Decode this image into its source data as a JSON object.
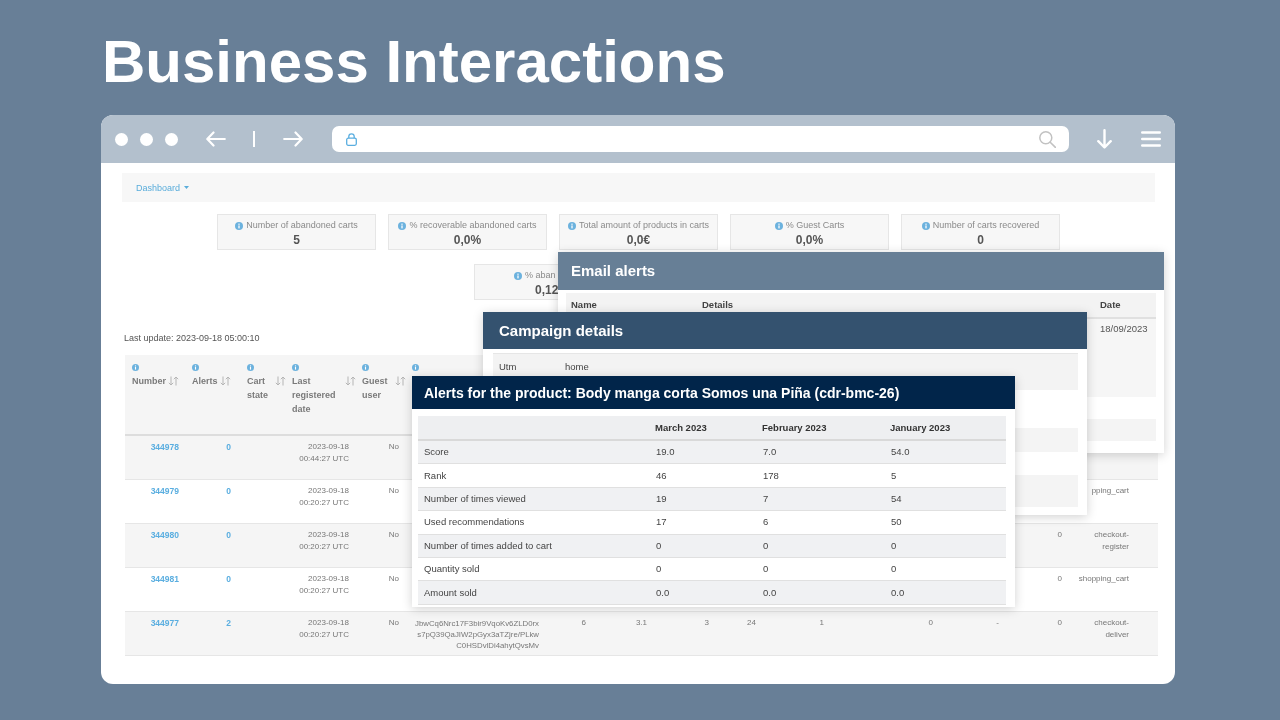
{
  "title": "Business Interactions",
  "dashboard_menu": {
    "label": "Dashboard"
  },
  "stats": [
    {
      "label": "Number of abandoned carts",
      "value": "5"
    },
    {
      "label": "% recoverable abandoned carts",
      "value": "0,0%"
    },
    {
      "label": "Total amount of products in carts",
      "value": "0,0€"
    },
    {
      "label": "% Guest Carts",
      "value": "0,0%"
    },
    {
      "label": "Number of carts recovered",
      "value": "0"
    }
  ],
  "stats_row_2": [
    {
      "label": "% aban",
      "value": "0,12"
    }
  ],
  "last_update": "Last update: 2023-09-18 05:00:10",
  "table": {
    "columns": [
      {
        "kind": "sortable",
        "label": "Number"
      },
      {
        "kind": "sortable",
        "label": "Alerts"
      },
      {
        "kind": "sortable",
        "label": "Cart state"
      },
      {
        "kind": "sortable",
        "label": "Last registered date"
      },
      {
        "kind": "sortable",
        "label": "Guest user"
      },
      {
        "kind": "info_only"
      }
    ],
    "rows": [
      {
        "number": "344978",
        "alerts": "0",
        "date": "2023-09-18",
        "time": "00:44:27 UTC",
        "guest_user": "No"
      },
      {
        "number": "344979",
        "alerts": "0",
        "date": "2023-09-18",
        "time": "00:20:27 UTC",
        "guest_user": "No",
        "column_15": "pping_cart"
      },
      {
        "number": "344980",
        "alerts": "0",
        "date": "2023-09-18",
        "time": "00:20:27 UTC",
        "guest_user": "No",
        "column_14": "0",
        "column_15": "checkout-register"
      },
      {
        "number": "344981",
        "alerts": "0",
        "date": "2023-09-18",
        "time": "00:20:27 UTC",
        "guest_user": "No",
        "column_14": "0",
        "column_15": "shopping_cart"
      },
      {
        "number": "344977",
        "alerts": "2",
        "date": "2023-09-18",
        "time": "00:20:27 UTC",
        "guest_user": "No",
        "column_6": "JbwCq6Nrc17F3bir9VqoKv6ZLD0rxs7pQ39QaJIW2pGyx3aTZjre/PLkwC0HSDvlDi4ahytQvsMv",
        "column_7": "6",
        "column_8": "3.1",
        "column_9": "3",
        "column_10": "24",
        "column_11": "1",
        "column_12": "0",
        "column_13": "-",
        "column_14": "0",
        "column_15": "checkout-deliver"
      }
    ]
  },
  "email_alerts": {
    "title": "Email alerts",
    "columns": [
      "Name",
      "Details",
      "Date"
    ],
    "rows": [
      {
        "date": "18/09/2023"
      }
    ]
  },
  "campaign_details": {
    "title": "Campaign details",
    "rows": [
      {
        "label": "Utm",
        "value": "home"
      }
    ]
  },
  "product_alerts": {
    "title": "Alerts for the product: Body manga corta Somos una Piña (cdr-bmc-26)",
    "columns": [
      "March 2023",
      "February 2023",
      "January 2023"
    ],
    "rows": [
      {
        "label": "Score",
        "values": [
          "19.0",
          "7.0",
          "54.0"
        ]
      },
      {
        "label": "Rank",
        "values": [
          "46",
          "178",
          "5"
        ]
      },
      {
        "label": "Number of times viewed",
        "values": [
          "19",
          "7",
          "54"
        ]
      },
      {
        "label": "Used recommendations",
        "values": [
          "17",
          "6",
          "50"
        ]
      },
      {
        "label": "Number of times added to cart",
        "values": [
          "0",
          "0",
          "0"
        ]
      },
      {
        "label": "Quantity sold",
        "values": [
          "0",
          "0",
          "0"
        ]
      },
      {
        "label": "Amount sold",
        "values": [
          "0.0",
          "0.0",
          "0.0"
        ]
      }
    ]
  }
}
